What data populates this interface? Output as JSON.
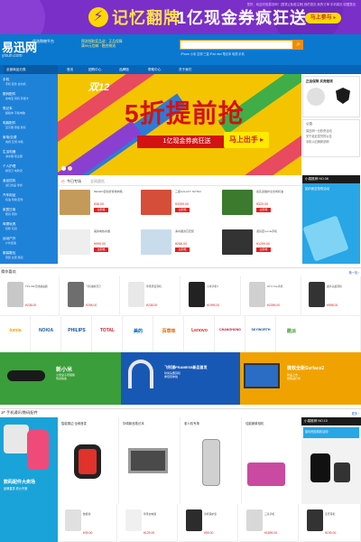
{
  "banner": {
    "topbar": "您好，欢迎光临易迅网！[登录] [免费注册]  我的易迅  我的订单  手机易迅  收藏易迅",
    "headline_part1": "记忆翻牌",
    "headline_part2": "1亿现金券疯狂送",
    "button": "马上参与 ▸",
    "colors": {
      "bg": "#7b2fc9",
      "yellow": "#ffd800"
    }
  },
  "header": {
    "logo": "易迅网",
    "logo_tagline": "优选购物平台",
    "logo_url": "yixun.com",
    "slogan_line1": "预测领取奖品送：正品保障",
    "slogan_line2": "满99元包邮 · 融合物流",
    "search_placeholder": "",
    "hot_links": "iPhone 小米 空调 三星 iPad mini 笔记本 电视 手机"
  },
  "nav": {
    "items": [
      "首页",
      "团购中心",
      "品牌馆",
      "帮助中心",
      "关于我们"
    ]
  },
  "category": {
    "title": "全部商品分类",
    "items": [
      {
        "label": "手机",
        "sub": "手机 配件 合约机"
      },
      {
        "label": "数码配件",
        "sub": "充电宝 耳机 存储卡"
      },
      {
        "label": "笔记本",
        "sub": "超极本 平板电脑"
      },
      {
        "label": "电脑配件",
        "sub": "显示器 键盘 鼠标"
      },
      {
        "label": "家电/空调",
        "sub": "电视 空调 冰箱"
      },
      {
        "label": "生活电器",
        "sub": "净水器 吸尘器"
      },
      {
        "label": "个人护理",
        "sub": "剃须刀 电吹风"
      },
      {
        "label": "食品饮料",
        "sub": "进口食品 零食"
      },
      {
        "label": "汽车用品",
        "sub": "机油 导航 配件"
      },
      {
        "label": "家居日用",
        "sub": "厨具 家纺"
      },
      {
        "label": "母婴玩具",
        "sub": "奶粉 玩具"
      },
      {
        "label": "运动户外",
        "sub": "户外装备"
      },
      {
        "label": "服装鞋包",
        "sub": "男装 女装 箱包"
      }
    ]
  },
  "hero": {
    "event": "双12",
    "title": "5折提前抢",
    "subtitle": "1亿现金券疯狂送",
    "button": "马上出手 ▸"
  },
  "right_panel": {
    "guarantee_title": "正品保障 买贵赔钱",
    "notice_title": "公告",
    "notices": [
      "易迅网一元秒杀活动",
      "关于延迟发货的公告",
      "手机以旧换新说明"
    ],
    "box1_title": "小易推荐 NO.08",
    "box1_text": "如约而至抢购活动",
    "box2_title": "小易推荐 NO.10",
    "box2_text": "如约而至精彩活动"
  },
  "deal_tabs": {
    "tab1": "今日专场",
    "tab2": "全网超低"
  },
  "deals": [
    {
      "name": "REGEN自动折叠收纳箱",
      "price": "¥36.00",
      "btn": "立即抢",
      "color": "#c49a5b"
    },
    {
      "name": "三星GALAXY NOTE3",
      "price": "¥3399.00",
      "btn": "立即抢",
      "color": "#d54e3a"
    },
    {
      "name": "嘉实多磁护全合成机油",
      "price": "¥329.00",
      "btn": "立即抢",
      "color": "#3c7a2e"
    },
    {
      "name": "飞利浦电吹风",
      "price": "¥129.00",
      "btn": "立即抢",
      "color": "#d8d8d8"
    },
    {
      "name": "美的电热水器",
      "price": "¥999.00",
      "btn": "立即抢",
      "color": "#eeeeee"
    },
    {
      "name": "净水器滤芯套装",
      "price": "¥268.00",
      "btn": "立即抢",
      "color": "#c9dceb"
    },
    {
      "name": "诺基亚Lumia手机",
      "price": "¥1299.00",
      "btn": "立即抢",
      "color": "#333333"
    },
    {
      "name": "移动电源10400mAh",
      "price": "¥99.00",
      "btn": "立即抢",
      "color": "#40b8e8"
    }
  ],
  "section_guess": {
    "title": "猜你喜欢",
    "more": "换一批 ›"
  },
  "guess_cards": [
    {
      "name": "TP-LINK无线路由器",
      "price": "¥238.00",
      "color": "#c8c8c8"
    },
    {
      "name": "飞利浦剃须刀",
      "price": "¥298.00",
      "color": "#6e6e6e"
    },
    {
      "name": "苹果原装耳机",
      "price": "¥238.00",
      "color": "#e8e8e8"
    },
    {
      "name": "小米手机3",
      "price": "¥1999.00",
      "color": "#222222"
    },
    {
      "name": "HTC One手机",
      "price": "¥2399.00",
      "color": "#d0d0d0"
    },
    {
      "name": "魔声头戴耳机",
      "price": "¥998.00",
      "color": "#333333"
    }
  ],
  "brands": [
    {
      "name": "lumia",
      "color": "#f5a200"
    },
    {
      "name": "NOKIA",
      "color": "#1b5aa6"
    },
    {
      "name": "PHILIPS",
      "color": "#0b4ea2"
    },
    {
      "name": "TOTAL",
      "color": "#d22630"
    },
    {
      "name": "美的",
      "color": "#0068b7"
    },
    {
      "name": "百草味",
      "color": "#e06c00"
    },
    {
      "name": "Lenovo",
      "color": "#e2231a"
    },
    {
      "name": "CHANGHONG",
      "color": "#c8102e"
    },
    {
      "name": "SKYWORTH",
      "color": "#1d4ea0"
    },
    {
      "name": "酷派",
      "color": "#4aa23b"
    }
  ],
  "promos": [
    {
      "title": "新小米",
      "sub": "小米盒子增强版\n现货热卖",
      "color": "#3a9e3a"
    },
    {
      "title": "飞利浦FRAMESS新品首发",
      "sub": "时尚头戴耳机\n重低音体验",
      "color": "#1858b5"
    },
    {
      "title": "微软全新Surface2",
      "sub": "新品上市\n抢购进行中",
      "color": "#f0a300"
    }
  ],
  "section_floor": {
    "title": "1F  手机通讯/数码配件",
    "more": "更多 ›"
  },
  "floor": {
    "main_title": "数码配件大卖场",
    "main_sub": "品牌直供 低价不断",
    "items": [
      {
        "name": "智能周边 全网首发",
        "color": "#e0322b"
      },
      {
        "name": "华硕新品笔记本",
        "color": "#8a8a8a"
      },
      {
        "name": "老人机专场",
        "color": "#d0d0d0"
      },
      {
        "name": "佳能微单相机",
        "color": "#c94aa0"
      }
    ]
  },
  "floor_row": [
    {
      "name": "数据线",
      "price": "¥39.00"
    },
    {
      "name": "苹果充电器",
      "price": "¥129.00"
    },
    {
      "name": "手机保护套",
      "price": "¥59.00"
    },
    {
      "name": "三星手机",
      "price": "¥1899.00"
    },
    {
      "name": "蓝牙耳机",
      "price": "¥199.00"
    }
  ]
}
